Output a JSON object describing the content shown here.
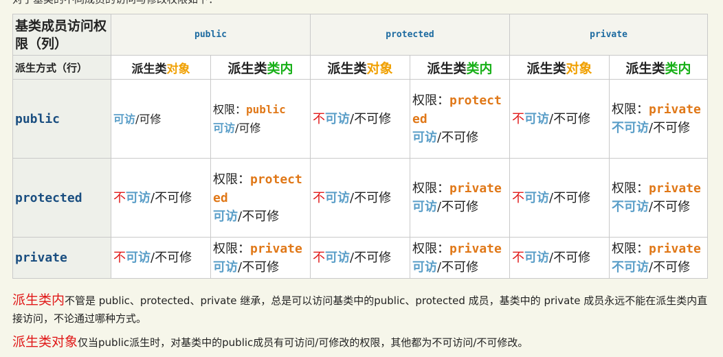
{
  "top_cut_text": "对于基类的不同成员的访问与修改权限如下：",
  "table": {
    "corner_title": "基类成员访问权限（列）",
    "corner_sub": "派生方式（行）",
    "columns": [
      "public",
      "protected",
      "private"
    ],
    "sub_prefix": "派生类",
    "sub_obj": "对象",
    "sub_in": "类内",
    "rows": [
      {
        "header": "public",
        "cells": [
          {
            "a": "可访",
            "b": "/可修"
          },
          {
            "perm": "权限：",
            "kw": "public",
            "a": "可访",
            "b": "/可修"
          },
          {
            "no": "不",
            "a": "可访",
            "b": "/不可修"
          },
          {
            "perm": "权限：",
            "kw": "protected",
            "a": "可访",
            "b": "/不可修"
          },
          {
            "no": "不",
            "a": "可访",
            "b": "/不可修"
          },
          {
            "perm": "权限：",
            "kw": "private",
            "no": "不",
            "a": "可访",
            "b": "/不可修"
          }
        ]
      },
      {
        "header": "protected",
        "cells": [
          {
            "no": "不",
            "a": "可访",
            "b": "/不可修"
          },
          {
            "perm": "权限：",
            "kw": "protected",
            "a": "可访",
            "b": "/不可修"
          },
          {
            "no": "不",
            "a": "可访",
            "b": "/不可修"
          },
          {
            "perm": "权限：",
            "kw": "private",
            "a": "可访",
            "b": "/不可修"
          },
          {
            "no": "不",
            "a": "可访",
            "b": "/不可修"
          },
          {
            "perm": "权限：",
            "kw": "private",
            "no": "不",
            "a": "可访",
            "b": "/不可修"
          }
        ]
      },
      {
        "header": "private",
        "cells": [
          {
            "no": "不",
            "a": "可访",
            "b": "/不可修"
          },
          {
            "perm": "权限：",
            "kw": "private",
            "a": "可访",
            "b": "/不可修"
          },
          {
            "no": "不",
            "a": "可访",
            "b": "/不可修"
          },
          {
            "perm": "权限：",
            "kw": "private",
            "a": "可访",
            "b": "/不可修"
          },
          {
            "no": "不",
            "a": "可访",
            "b": "/不可修"
          },
          {
            "perm": "权限：",
            "kw": "private",
            "no": "不",
            "a": "可访",
            "b": "/不可修"
          }
        ]
      }
    ]
  },
  "notes": {
    "n1_lead": "派生类内",
    "n1_text": "不管是 public、protected、private 继承，总是可以访问基类中的public、protected 成员，基类中的 private 成员永远不能在派生类内直接访问，不论通过哪种方式。",
    "n2_lead": "派生类对象",
    "n2_text": "仅当public派生时，对基类中的public成员有可访问/可修改的权限，其他都为不可访问/不可修改。"
  },
  "colors": {
    "red": "#e01818",
    "blue": "#5a9ec8",
    "orange": "#f0a000",
    "green": "#18b018",
    "keyword": "#e07818",
    "column_header": "#1c6aa0"
  }
}
